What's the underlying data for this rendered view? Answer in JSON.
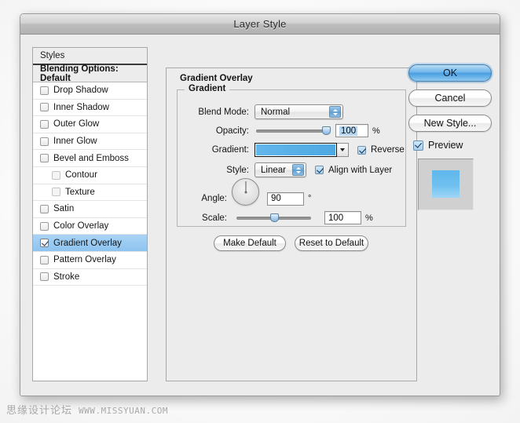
{
  "window": {
    "title": "Layer Style"
  },
  "styles_panel": {
    "header": "Styles",
    "blending_options": "Blending Options: Default",
    "items": [
      {
        "label": "Drop Shadow",
        "checked": false,
        "indent": false,
        "selected": false
      },
      {
        "label": "Inner Shadow",
        "checked": false,
        "indent": false,
        "selected": false
      },
      {
        "label": "Outer Glow",
        "checked": false,
        "indent": false,
        "selected": false
      },
      {
        "label": "Inner Glow",
        "checked": false,
        "indent": false,
        "selected": false
      },
      {
        "label": "Bevel and Emboss",
        "checked": false,
        "indent": false,
        "selected": false
      },
      {
        "label": "Contour",
        "checked": false,
        "indent": true,
        "selected": false
      },
      {
        "label": "Texture",
        "checked": false,
        "indent": true,
        "selected": false
      },
      {
        "label": "Satin",
        "checked": false,
        "indent": false,
        "selected": false
      },
      {
        "label": "Color Overlay",
        "checked": false,
        "indent": false,
        "selected": false
      },
      {
        "label": "Gradient Overlay",
        "checked": true,
        "indent": false,
        "selected": true
      },
      {
        "label": "Pattern Overlay",
        "checked": false,
        "indent": false,
        "selected": false
      },
      {
        "label": "Stroke",
        "checked": false,
        "indent": false,
        "selected": false
      }
    ]
  },
  "main": {
    "group_title": "Gradient Overlay",
    "sub_group_title": "Gradient",
    "blend_mode": {
      "label": "Blend Mode:",
      "value": "Normal"
    },
    "opacity": {
      "label": "Opacity:",
      "value": "100",
      "unit": "%",
      "slider_percent": 100
    },
    "gradient": {
      "label": "Gradient:",
      "start_color": "#62b7ec",
      "end_color": "#4ea8e2",
      "reverse_label": "Reverse",
      "reverse_checked": true
    },
    "style": {
      "label": "Style:",
      "value": "Linear",
      "align_label": "Align with Layer",
      "align_checked": true
    },
    "angle": {
      "label": "Angle:",
      "value": "90",
      "unit": "°",
      "degrees": 90
    },
    "scale": {
      "label": "Scale:",
      "value": "100",
      "unit": "%",
      "slider_percent": 50
    },
    "make_default": "Make Default",
    "reset_to_default": "Reset to Default"
  },
  "actions": {
    "ok": "OK",
    "cancel": "Cancel",
    "new_style": "New Style...",
    "preview_label": "Preview",
    "preview_checked": true
  },
  "watermark": {
    "site_cn": "思缘设计论坛",
    "site_url": "WWW.MISSYUAN.COM"
  }
}
